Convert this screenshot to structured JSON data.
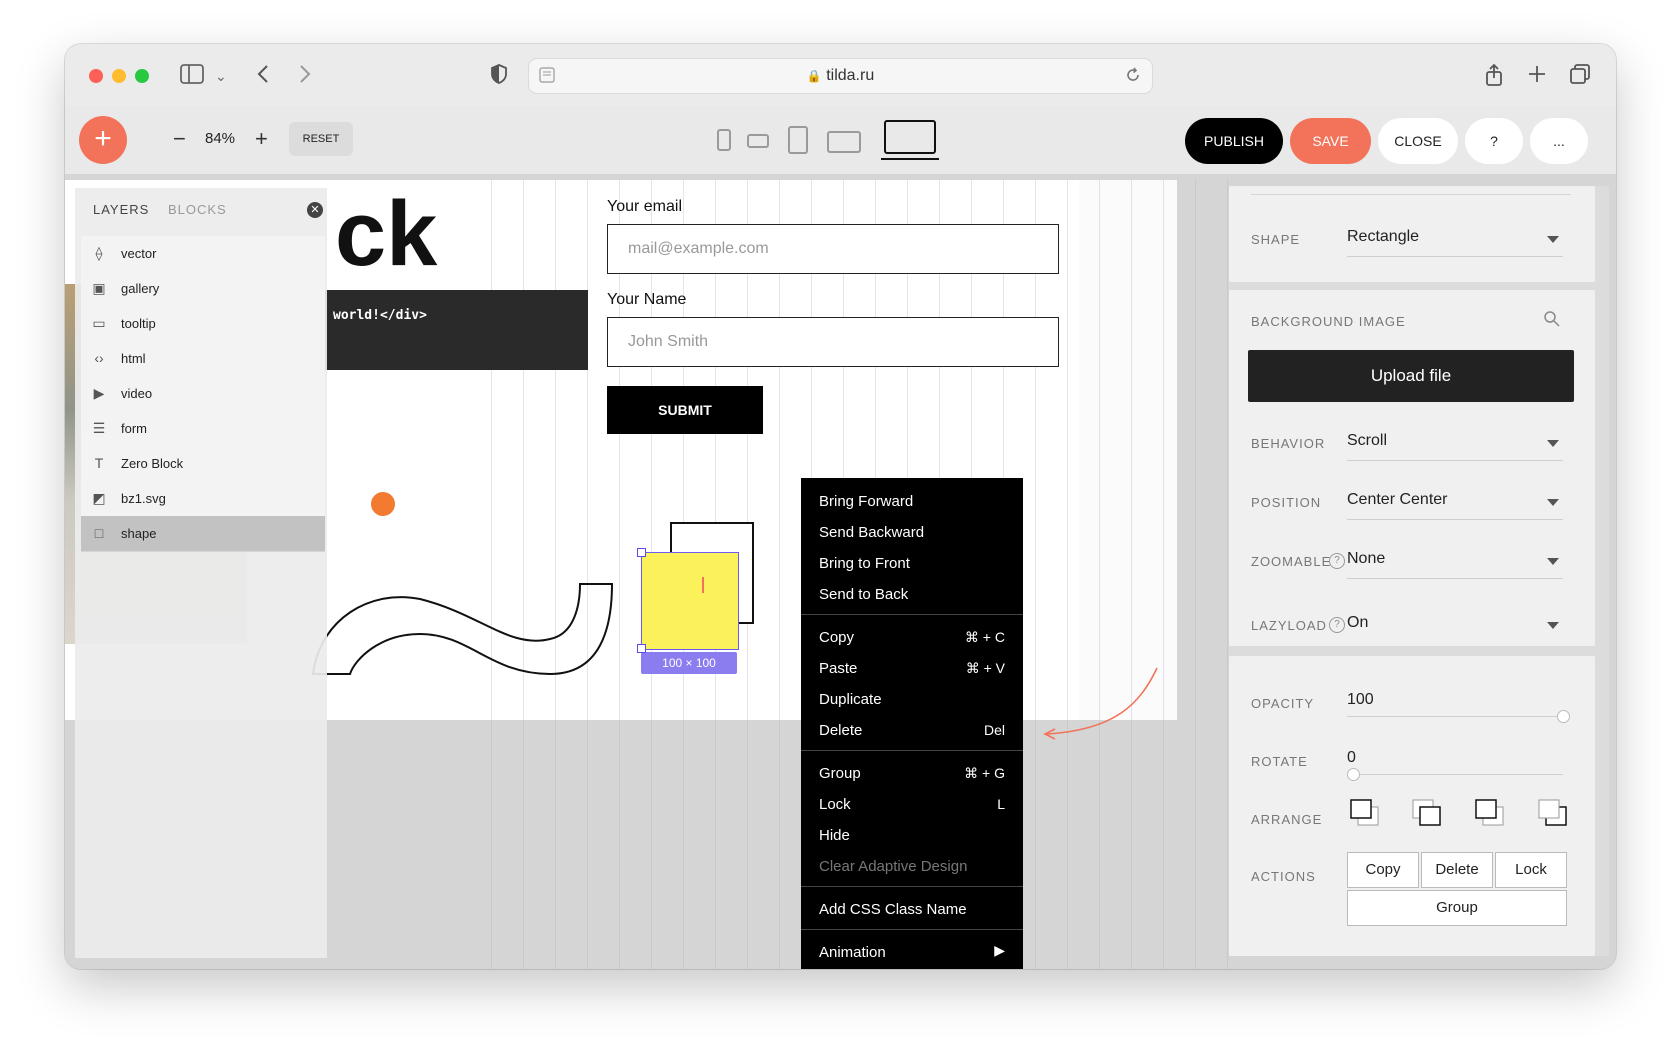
{
  "browser": {
    "url": "tilda.ru"
  },
  "toolbar": {
    "add_label": "+",
    "zoom_minus": "−",
    "zoom_value": "84%",
    "zoom_plus": "+",
    "reset_label": "RESET",
    "publish_label": "PUBLISH",
    "save_label": "SAVE",
    "close_label": "CLOSE",
    "help_label": "?",
    "more_label": "...",
    "colors": {
      "accent": "#f2735a",
      "dark": "#000000"
    }
  },
  "layers_panel": {
    "tab_layers": "LAYERS",
    "tab_blocks": "BLOCKS",
    "items": [
      {
        "label": "vector",
        "icon": "vector-icon"
      },
      {
        "label": "gallery",
        "icon": "gallery-icon"
      },
      {
        "label": "tooltip",
        "icon": "tooltip-icon"
      },
      {
        "label": "html",
        "icon": "code-icon"
      },
      {
        "label": "video",
        "icon": "play-icon"
      },
      {
        "label": "form",
        "icon": "form-icon"
      },
      {
        "label": "Zero Block",
        "icon": "text-icon"
      },
      {
        "label": "bz1.svg",
        "icon": "svg-icon"
      },
      {
        "label": "shape",
        "icon": "shape-icon",
        "selected": true
      }
    ]
  },
  "canvas": {
    "heading_text": "ck",
    "code_text": "world!</div>",
    "form": {
      "email_label": "Your email",
      "email_placeholder": "mail@example.com",
      "name_label": "Your Name",
      "name_placeholder": "John Smith",
      "submit_label": "SUBMIT"
    },
    "selection_size": "100 × 100"
  },
  "context_menu": {
    "groups": [
      [
        {
          "label": "Bring Forward"
        },
        {
          "label": "Send Backward"
        },
        {
          "label": "Bring to Front"
        },
        {
          "label": "Send to Back"
        }
      ],
      [
        {
          "label": "Copy",
          "shortcut": "⌘ + C"
        },
        {
          "label": "Paste",
          "shortcut": "⌘ + V"
        },
        {
          "label": "Duplicate"
        },
        {
          "label": "Delete",
          "shortcut": "Del"
        }
      ],
      [
        {
          "label": "Group",
          "shortcut": "⌘ + G"
        },
        {
          "label": "Lock",
          "shortcut": "L"
        },
        {
          "label": "Hide"
        },
        {
          "label": "Clear Adaptive Design",
          "disabled": true
        }
      ],
      [
        {
          "label": "Add CSS Class Name"
        }
      ],
      [
        {
          "label": "Animation",
          "submenu": true
        }
      ]
    ]
  },
  "settings_panel": {
    "shape_label": "SHAPE",
    "shape_value": "Rectangle",
    "bg_image_label": "BACKGROUND IMAGE",
    "upload_label": "Upload file",
    "behavior_label": "BEHAVIOR",
    "behavior_value": "Scroll",
    "position_label": "POSITION",
    "position_value": "Center Center",
    "zoomable_label": "ZOOMABLE",
    "zoomable_value": "None",
    "lazyload_label": "LAZYLOAD",
    "lazyload_value": "On",
    "opacity_label": "OPACITY",
    "opacity_value": "100",
    "rotate_label": "ROTATE",
    "rotate_value": "0",
    "arrange_label": "ARRANGE",
    "actions_label": "ACTIONS",
    "action_copy": "Copy",
    "action_delete": "Delete",
    "action_lock": "Lock",
    "action_group": "Group"
  }
}
